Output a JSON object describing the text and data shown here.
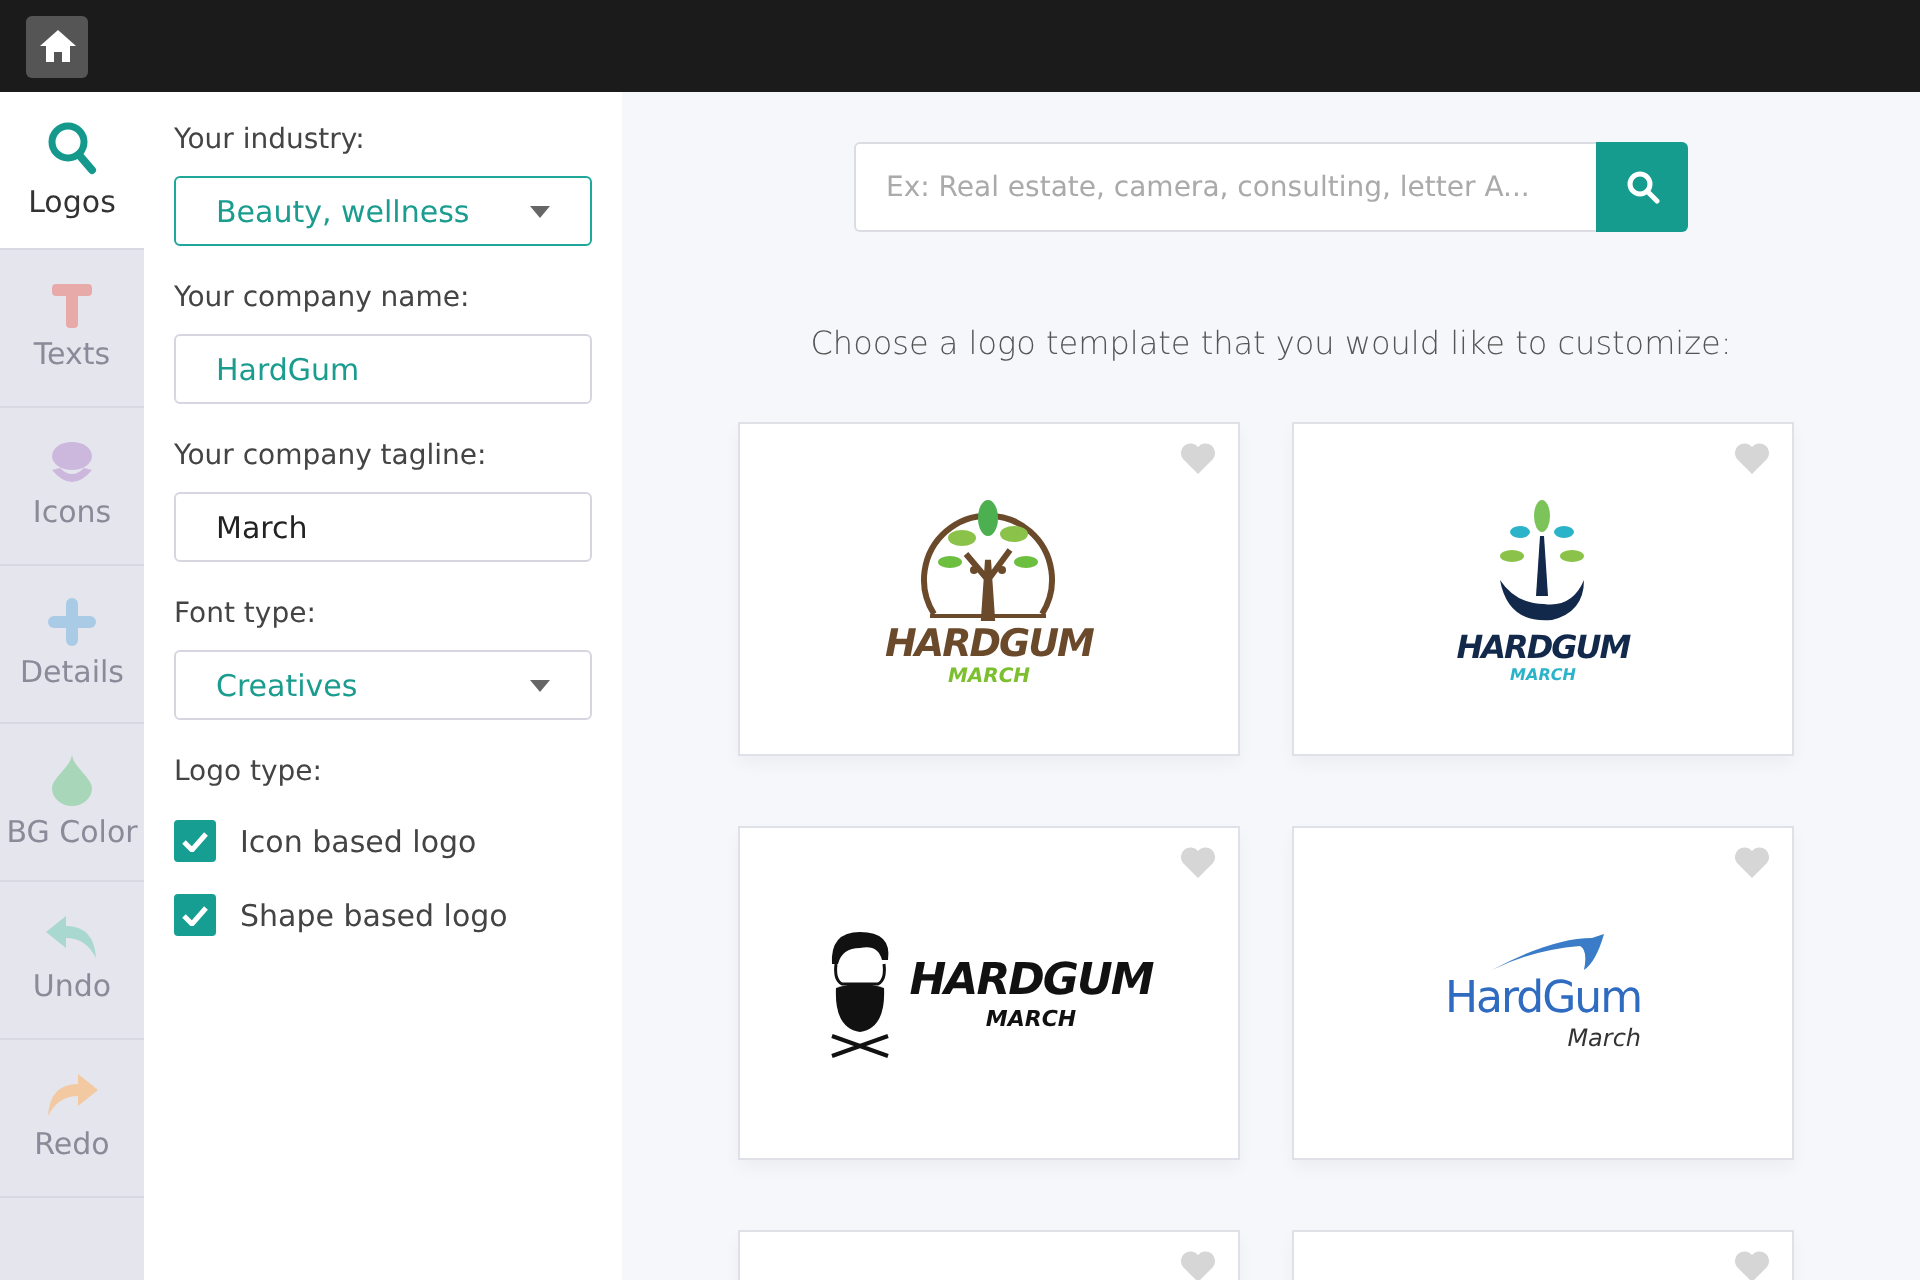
{
  "tools": [
    {
      "kind": "search",
      "label": "Logos",
      "selected": true
    },
    {
      "kind": "text",
      "label": "Texts",
      "selected": false
    },
    {
      "kind": "icons",
      "label": "Icons",
      "selected": false
    },
    {
      "kind": "plus",
      "label": "Details",
      "selected": false
    },
    {
      "kind": "drop",
      "label": "BG Color",
      "selected": false
    },
    {
      "kind": "undo",
      "label": "Undo",
      "selected": false
    },
    {
      "kind": "redo",
      "label": "Redo",
      "selected": false
    }
  ],
  "form": {
    "industry_label": "Your industry:",
    "industry": "Beauty, wellness",
    "name_label": "Your company name:",
    "name": "HardGum",
    "tagline_label": "Your company tagline:",
    "tagline": "March",
    "font_label": "Font type:",
    "font": "Creatives",
    "logo_type_label": "Logo type:",
    "options": [
      {
        "label": "Icon based logo",
        "checked": true
      },
      {
        "label": "Shape based logo",
        "checked": true
      }
    ]
  },
  "search": {
    "placeholder": "Ex: Real estate, camera, consulting, letter A..."
  },
  "heading": "Choose a logo template that you would like to customize:",
  "cards": [
    {
      "kind": "tree-circle",
      "name": "HARDGUM",
      "tagline": "MARCH",
      "favorite": false
    },
    {
      "kind": "tree-hand",
      "name": "HARDGUM",
      "tagline": "MARCH",
      "favorite": false
    },
    {
      "kind": "barber",
      "name": "HARDGUM",
      "tagline": "MARCH",
      "favorite": false
    },
    {
      "kind": "swoosh",
      "name": "HardGum",
      "tagline": "March",
      "favorite": false
    },
    {
      "kind": "partial",
      "favorite": false
    },
    {
      "kind": "partial",
      "favorite": false
    }
  ]
}
